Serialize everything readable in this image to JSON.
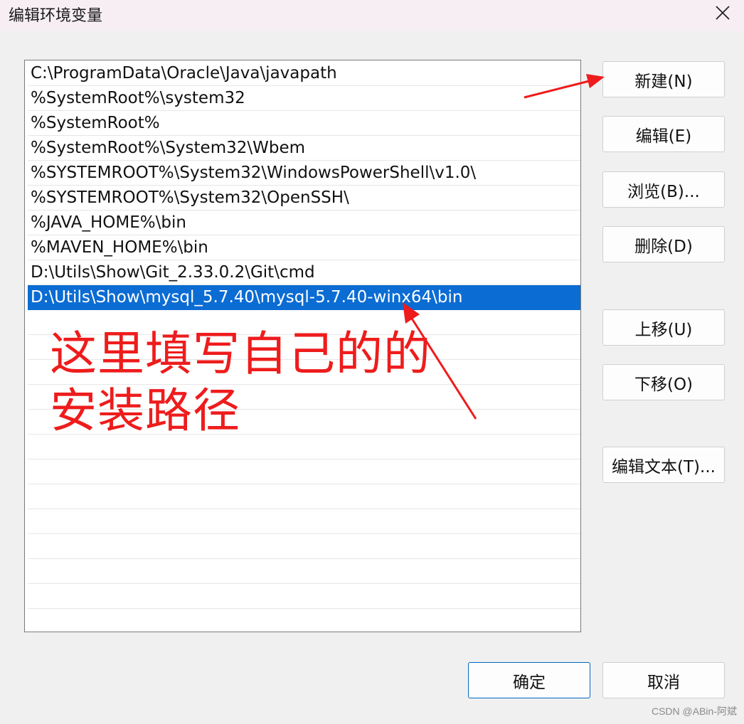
{
  "window": {
    "title": "编辑环境变量",
    "close_icon": "close-icon"
  },
  "path_list": {
    "selected_index": 9,
    "items": [
      "C:\\ProgramData\\Oracle\\Java\\javapath",
      "%SystemRoot%\\system32",
      "%SystemRoot%",
      "%SystemRoot%\\System32\\Wbem",
      "%SYSTEMROOT%\\System32\\WindowsPowerShell\\v1.0\\",
      "%SYSTEMROOT%\\System32\\OpenSSH\\",
      "%JAVA_HOME%\\bin",
      "%MAVEN_HOME%\\bin",
      "D:\\Utils\\Show\\Git_2.33.0.2\\Git\\cmd",
      "D:\\Utils\\Show\\mysql_5.7.40\\mysql-5.7.40-winx64\\bin"
    ]
  },
  "buttons": {
    "new": "新建(N)",
    "edit": "编辑(E)",
    "browse": "浏览(B)...",
    "delete": "删除(D)",
    "move_up": "上移(U)",
    "move_down": "下移(O)",
    "edit_text": "编辑文本(T)...",
    "ok": "确定",
    "cancel": "取消"
  },
  "annotation": {
    "text": "这里填写自己的的安装路径",
    "color": "#ee1c1c"
  },
  "watermark": "CSDN @ABin-阿斌",
  "colors": {
    "selection": "#0b6cd3",
    "title_bar": "#f6eef3",
    "primary_border": "#0067c0"
  }
}
